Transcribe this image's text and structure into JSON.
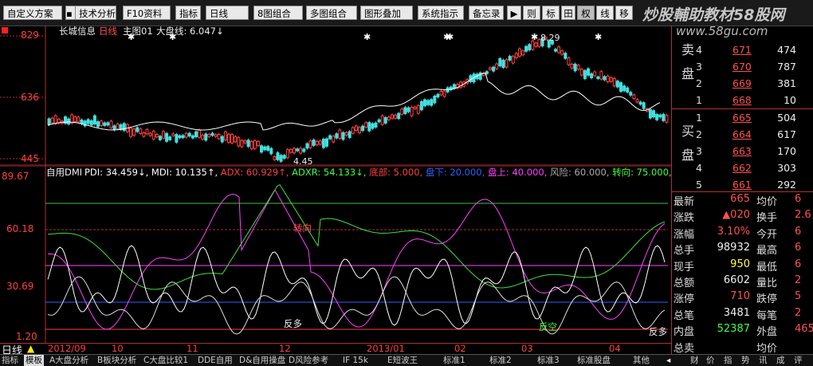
{
  "toolbar": {
    "buttons": [
      "自定义方案",
      "技术分析",
      "F10资料",
      "指标",
      "日线",
      "8图组合",
      "多图组合",
      "图形叠加",
      "系统指示",
      "备忘录"
    ],
    "small_buttons": [
      "则",
      "标",
      "田",
      "权",
      "线",
      "移"
    ]
  },
  "watermark": {
    "line1": "炒股輔助教材58股网",
    "line2": "www.58gu.com"
  },
  "price_chart": {
    "header_stock": "长城信息",
    "header_period": "日线",
    "header_main": "主图01",
    "header_index": "大盘线: 6.047↓",
    "y_labels": [
      "829",
      "636",
      "445"
    ],
    "high_label": "8.29",
    "low_label": "4.45"
  },
  "indicator": {
    "name": "自用DMI",
    "params": [
      {
        "text": "PDI: 34.459↓,",
        "color": "#ffffff"
      },
      {
        "text": "MDI: 10.135↑,",
        "color": "#ffffff"
      },
      {
        "text": "ADX: 60.929↑,",
        "color": "#ff4040"
      },
      {
        "text": "ADXR: 54.133↓,",
        "color": "#40ff40"
      },
      {
        "text": "底部: 5.000,",
        "color": "#ff4040"
      },
      {
        "text": "盘下: 20.000,",
        "color": "#3060ff"
      },
      {
        "text": "盘上: 40.000,",
        "color": "#ff40ff"
      },
      {
        "text": "风险: 60.000,",
        "color": "#aaaaaa"
      },
      {
        "text": "转向: 75.000,",
        "color": "#40ff40"
      }
    ],
    "y_labels": [
      "89.67",
      "60.18",
      "30.69",
      "1.20"
    ],
    "annotations": {
      "a1": "转向",
      "a2": "反多",
      "a3": "反空",
      "a4": "反多"
    }
  },
  "date_axis": {
    "period": "日线",
    "labels": [
      "2012/09",
      "10",
      "11",
      "12",
      "2013/01",
      "02",
      "03",
      "04"
    ]
  },
  "bottom_tabs": [
    "指标",
    "模板",
    "A大盘分析",
    "B板块分析",
    "C大盘比较1",
    "DDE自用",
    "D&自用操盘",
    "D风险参考",
    "IF 15k",
    "E短波王",
    "标准1",
    "标准2",
    "标准3",
    "标准股盘",
    "其他"
  ],
  "side_tabs": [
    "财",
    "价",
    "指",
    "势",
    "讯",
    "成",
    "评"
  ],
  "order_book": {
    "sell_label": "卖盘",
    "buy_label": "买盘",
    "sells": [
      {
        "n": "4",
        "price": "671",
        "vol": "474"
      },
      {
        "n": "3",
        "price": "670",
        "vol": "787"
      },
      {
        "n": "2",
        "price": "669",
        "vol": "381"
      },
      {
        "n": "1",
        "price": "668",
        "vol": "10"
      }
    ],
    "buys": [
      {
        "n": "1",
        "price": "665",
        "vol": "504"
      },
      {
        "n": "2",
        "price": "664",
        "vol": "617"
      },
      {
        "n": "3",
        "price": "663",
        "vol": "170"
      },
      {
        "n": "4",
        "price": "662",
        "vol": "303"
      },
      {
        "n": "5",
        "price": "661",
        "vol": "292"
      }
    ]
  },
  "stats": [
    {
      "k1": "最新",
      "v1": "665",
      "c1": "#ff5050",
      "k2": "均价",
      "v2": "6"
    },
    {
      "k1": "涨跌",
      "v1": "▲020",
      "c1": "#ff5050",
      "k2": "换手",
      "v2": "2.6"
    },
    {
      "k1": "涨幅",
      "v1": "3.10%",
      "c1": "#ff5050",
      "k2": "今开",
      "v2": "6"
    },
    {
      "k1": "总手",
      "v1": "98932",
      "c1": "#eeeeee",
      "k2": "最高",
      "v2": "6"
    },
    {
      "k1": "现手",
      "v1": "950",
      "c1": "#ffff40",
      "k2": "最低",
      "v2": "6"
    },
    {
      "k1": "总额",
      "v1": "6602",
      "c1": "#eeeeee",
      "k2": "量比",
      "v2": "2"
    },
    {
      "k1": "涨停",
      "v1": "710",
      "c1": "#ff5050",
      "k2": "跌停",
      "v2": "5"
    },
    {
      "k1": "总笔",
      "v1": "3481",
      "c1": "#eeeeee",
      "k2": "每笔",
      "v2": "2"
    },
    {
      "k1": "内盘",
      "v1": "52387",
      "c1": "#40ff40",
      "k2": "外盘",
      "v2": "465"
    },
    {
      "k1": "总卖",
      "v1": "",
      "c1": "#eeeeee",
      "k2": "均价",
      "v2": ""
    }
  ]
}
